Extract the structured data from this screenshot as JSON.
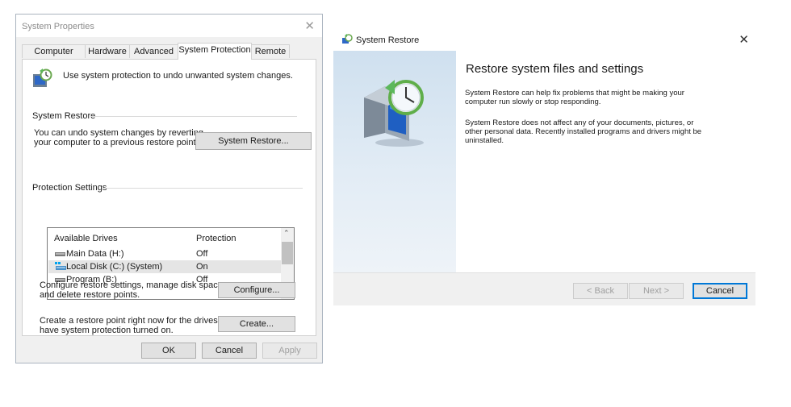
{
  "system_properties": {
    "title": "System Properties",
    "tabs": [
      "Computer Name",
      "Hardware",
      "Advanced",
      "System Protection",
      "Remote"
    ],
    "active_tab": "System Protection",
    "intro": "Use system protection to undo unwanted system changes.",
    "restore_group": {
      "label": "System Restore",
      "description_line1": "You can undo system changes by reverting",
      "description_line2": "your computer to a previous restore point.",
      "button": "System Restore..."
    },
    "protection_group": {
      "label": "Protection Settings",
      "columns": [
        "Available Drives",
        "Protection"
      ],
      "drives": [
        {
          "name": "Main Data (H:)",
          "protection": "Off",
          "icon": "drive-icon",
          "selected": false
        },
        {
          "name": "Local Disk (C:) (System)",
          "protection": "On",
          "icon": "system-drive-icon",
          "selected": true
        },
        {
          "name": "Program (B:)",
          "protection": "Off",
          "icon": "drive-icon",
          "selected": false
        }
      ],
      "configure_text_line1": "Configure restore settings, manage disk space,",
      "configure_text_line2": "and delete restore points.",
      "configure_button": "Configure...",
      "create_text_line1": "Create a restore point right now for the drives that",
      "create_text_line2": "have system protection turned on.",
      "create_button": "Create..."
    },
    "buttons": {
      "ok": "OK",
      "cancel": "Cancel",
      "apply": "Apply"
    }
  },
  "system_restore": {
    "title": "System Restore",
    "heading": "Restore system files and settings",
    "para1_line1": "System Restore can help fix problems that might be making your",
    "para1_line2": "computer run slowly or stop responding.",
    "para2_line1": "System Restore does not affect any of your documents, pictures, or",
    "para2_line2": "other personal data. Recently installed programs and drivers might be",
    "para2_line3": "uninstalled.",
    "buttons": {
      "back": "< Back",
      "next": "Next >",
      "cancel": "Cancel"
    }
  },
  "colors": {
    "accent": "#0078d7",
    "disabled_text": "#a0a0a0",
    "sidebar": "#dce8f3"
  }
}
